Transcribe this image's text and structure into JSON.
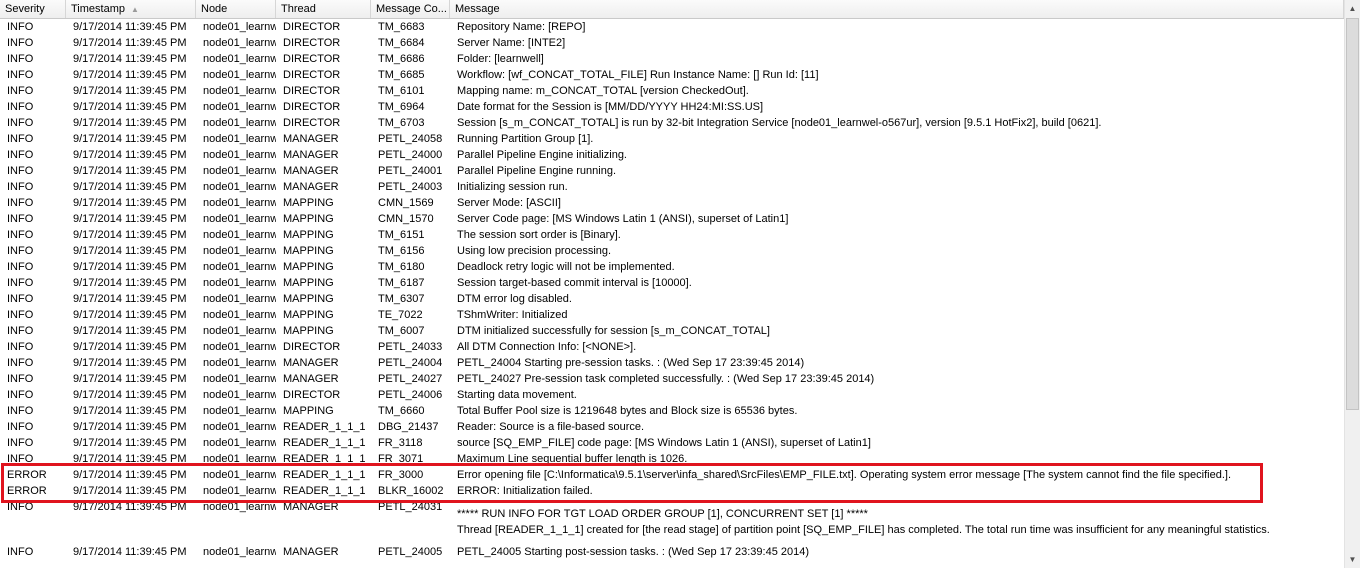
{
  "columns": [
    {
      "label": "Severity"
    },
    {
      "label": "Timestamp",
      "sorted": true
    },
    {
      "label": "Node"
    },
    {
      "label": "Thread"
    },
    {
      "label": "Message Co..."
    },
    {
      "label": "Message"
    }
  ],
  "icons": {
    "sort": "sort-ascending-icon",
    "up": "scroll-up-icon",
    "down": "scroll-down-icon"
  },
  "highlight_color": "#e0141e",
  "rows": [
    {
      "severity": "INFO",
      "timestamp": "9/17/2014 11:39:45 PM",
      "node": "node01_learnw",
      "thread": "DIRECTOR",
      "code": "TM_6683",
      "message": "Repository Name: [REPO]"
    },
    {
      "severity": "INFO",
      "timestamp": "9/17/2014 11:39:45 PM",
      "node": "node01_learnw",
      "thread": "DIRECTOR",
      "code": "TM_6684",
      "message": "Server Name: [INTE2]"
    },
    {
      "severity": "INFO",
      "timestamp": "9/17/2014 11:39:45 PM",
      "node": "node01_learnw",
      "thread": "DIRECTOR",
      "code": "TM_6686",
      "message": "Folder: [learnwell]"
    },
    {
      "severity": "INFO",
      "timestamp": "9/17/2014 11:39:45 PM",
      "node": "node01_learnw",
      "thread": "DIRECTOR",
      "code": "TM_6685",
      "message": "Workflow: [wf_CONCAT_TOTAL_FILE] Run Instance Name: [] Run Id: [11]"
    },
    {
      "severity": "INFO",
      "timestamp": "9/17/2014 11:39:45 PM",
      "node": "node01_learnw",
      "thread": "DIRECTOR",
      "code": "TM_6101",
      "message": "Mapping name: m_CONCAT_TOTAL [version CheckedOut]."
    },
    {
      "severity": "INFO",
      "timestamp": "9/17/2014 11:39:45 PM",
      "node": "node01_learnw",
      "thread": "DIRECTOR",
      "code": "TM_6964",
      "message": "Date format for the Session is [MM/DD/YYYY HH24:MI:SS.US]"
    },
    {
      "severity": "INFO",
      "timestamp": "9/17/2014 11:39:45 PM",
      "node": "node01_learnw",
      "thread": "DIRECTOR",
      "code": "TM_6703",
      "message": "Session [s_m_CONCAT_TOTAL] is run by 32-bit Integration Service  [node01_learnwel-o567ur], version [9.5.1 HotFix2], build [0621]."
    },
    {
      "severity": "INFO",
      "timestamp": "9/17/2014 11:39:45 PM",
      "node": "node01_learnw",
      "thread": "MANAGER",
      "code": "PETL_24058",
      "message": "Running Partition Group [1]."
    },
    {
      "severity": "INFO",
      "timestamp": "9/17/2014 11:39:45 PM",
      "node": "node01_learnw",
      "thread": "MANAGER",
      "code": "PETL_24000",
      "message": "Parallel Pipeline Engine initializing."
    },
    {
      "severity": "INFO",
      "timestamp": "9/17/2014 11:39:45 PM",
      "node": "node01_learnw",
      "thread": "MANAGER",
      "code": "PETL_24001",
      "message": "Parallel Pipeline Engine running."
    },
    {
      "severity": "INFO",
      "timestamp": "9/17/2014 11:39:45 PM",
      "node": "node01_learnw",
      "thread": "MANAGER",
      "code": "PETL_24003",
      "message": "Initializing session run."
    },
    {
      "severity": "INFO",
      "timestamp": "9/17/2014 11:39:45 PM",
      "node": "node01_learnw",
      "thread": "MAPPING",
      "code": "CMN_1569",
      "message": "Server Mode: [ASCII]"
    },
    {
      "severity": "INFO",
      "timestamp": "9/17/2014 11:39:45 PM",
      "node": "node01_learnw",
      "thread": "MAPPING",
      "code": "CMN_1570",
      "message": "Server Code page: [MS Windows Latin 1 (ANSI), superset of Latin1]"
    },
    {
      "severity": "INFO",
      "timestamp": "9/17/2014 11:39:45 PM",
      "node": "node01_learnw",
      "thread": "MAPPING",
      "code": "TM_6151",
      "message": "The session sort order is [Binary]."
    },
    {
      "severity": "INFO",
      "timestamp": "9/17/2014 11:39:45 PM",
      "node": "node01_learnw",
      "thread": "MAPPING",
      "code": "TM_6156",
      "message": "Using low precision processing."
    },
    {
      "severity": "INFO",
      "timestamp": "9/17/2014 11:39:45 PM",
      "node": "node01_learnw",
      "thread": "MAPPING",
      "code": "TM_6180",
      "message": "Deadlock retry logic will not be implemented."
    },
    {
      "severity": "INFO",
      "timestamp": "9/17/2014 11:39:45 PM",
      "node": "node01_learnw",
      "thread": "MAPPING",
      "code": "TM_6187",
      "message": "Session target-based commit interval is [10000]."
    },
    {
      "severity": "INFO",
      "timestamp": "9/17/2014 11:39:45 PM",
      "node": "node01_learnw",
      "thread": "MAPPING",
      "code": "TM_6307",
      "message": "DTM error log disabled."
    },
    {
      "severity": "INFO",
      "timestamp": "9/17/2014 11:39:45 PM",
      "node": "node01_learnw",
      "thread": "MAPPING",
      "code": "TE_7022",
      "message": "TShmWriter: Initialized"
    },
    {
      "severity": "INFO",
      "timestamp": "9/17/2014 11:39:45 PM",
      "node": "node01_learnw",
      "thread": "MAPPING",
      "code": "TM_6007",
      "message": "DTM initialized successfully for session [s_m_CONCAT_TOTAL]"
    },
    {
      "severity": "INFO",
      "timestamp": "9/17/2014 11:39:45 PM",
      "node": "node01_learnw",
      "thread": "DIRECTOR",
      "code": "PETL_24033",
      "message": "All DTM Connection Info: [<NONE>]."
    },
    {
      "severity": "INFO",
      "timestamp": "9/17/2014 11:39:45 PM",
      "node": "node01_learnw",
      "thread": "MANAGER",
      "code": "PETL_24004",
      "message": "PETL_24004 Starting pre-session tasks. : (Wed Sep 17 23:39:45 2014)"
    },
    {
      "severity": "INFO",
      "timestamp": "9/17/2014 11:39:45 PM",
      "node": "node01_learnw",
      "thread": "MANAGER",
      "code": "PETL_24027",
      "message": "PETL_24027 Pre-session task completed successfully. : (Wed Sep 17 23:39:45 2014)"
    },
    {
      "severity": "INFO",
      "timestamp": "9/17/2014 11:39:45 PM",
      "node": "node01_learnw",
      "thread": "DIRECTOR",
      "code": "PETL_24006",
      "message": "Starting data movement."
    },
    {
      "severity": "INFO",
      "timestamp": "9/17/2014 11:39:45 PM",
      "node": "node01_learnw",
      "thread": "MAPPING",
      "code": "TM_6660",
      "message": "Total Buffer Pool size is 1219648 bytes and Block size is 65536 bytes."
    },
    {
      "severity": "INFO",
      "timestamp": "9/17/2014 11:39:45 PM",
      "node": "node01_learnw",
      "thread": "READER_1_1_1",
      "code": "DBG_21437",
      "message": "Reader: Source is a file-based source."
    },
    {
      "severity": "INFO",
      "timestamp": "9/17/2014 11:39:45 PM",
      "node": "node01_learnw",
      "thread": "READER_1_1_1",
      "code": "FR_3118",
      "message": "source [SQ_EMP_FILE] code page: [MS Windows Latin 1 (ANSI), superset of Latin1]"
    },
    {
      "severity": "INFO",
      "timestamp": "9/17/2014 11:39:45 PM",
      "node": "node01_learnw",
      "thread": "READER_1_1_1",
      "code": "FR_3071",
      "message": "Maximum Line sequential buffer length is 1026."
    },
    {
      "severity": "ERROR",
      "timestamp": "9/17/2014 11:39:45 PM",
      "node": "node01_learnw",
      "thread": "READER_1_1_1",
      "code": "FR_3000",
      "message": "Error opening file [C:\\Informatica\\9.5.1\\server\\infa_shared\\SrcFiles\\EMP_FILE.txt].  Operating system error message [The system cannot find the file specified.]."
    },
    {
      "severity": "ERROR",
      "timestamp": "9/17/2014 11:39:45 PM",
      "node": "node01_learnw",
      "thread": "READER_1_1_1",
      "code": "BLKR_16002",
      "message": "ERROR: Initialization failed."
    },
    {
      "severity": "INFO",
      "timestamp": "9/17/2014 11:39:45 PM",
      "node": "node01_learnw",
      "thread": "MANAGER",
      "code": "PETL_24031",
      "message": "",
      "extra_lines": [
        "***** RUN INFO FOR TGT LOAD ORDER GROUP [1], CONCURRENT SET [1] *****",
        "Thread [READER_1_1_1] created for [the read stage] of partition point [SQ_EMP_FILE] has completed. The total run time was insufficient for any meaningful statistics."
      ]
    },
    {
      "severity": "INFO",
      "timestamp": "9/17/2014 11:39:45 PM",
      "node": "node01_learnw",
      "thread": "MANAGER",
      "code": "PETL_24005",
      "message": "PETL_24005 Starting post-session tasks. : (Wed Sep 17 23:39:45 2014)"
    }
  ]
}
